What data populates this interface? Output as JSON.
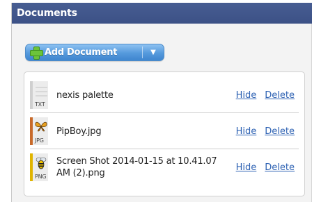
{
  "panel": {
    "title": "Documents"
  },
  "toolbar": {
    "add_label": "Add Document",
    "add_dropdown_icon": "caret-down-icon"
  },
  "documents": [
    {
      "name": "nexis palette",
      "type_label": "TXT",
      "icon": "text-file-icon",
      "stripe_color": "#cfcfcf",
      "hide_label": "Hide",
      "delete_label": "Delete"
    },
    {
      "name": "PipBoy.jpg",
      "type_label": "JPG",
      "icon": "butterfly-image-icon",
      "stripe_color": "#c86a2a",
      "hide_label": "Hide",
      "delete_label": "Delete"
    },
    {
      "name": "Screen Shot 2014-01-15 at 10.41.07 AM (2).png",
      "type_label": "PNG",
      "icon": "bee-image-icon",
      "stripe_color": "#e0b400",
      "hide_label": "Hide",
      "delete_label": "Delete"
    }
  ],
  "colors": {
    "header_bg": "#3f5489",
    "button_blue": "#5599dc",
    "link": "#2e62b3"
  }
}
